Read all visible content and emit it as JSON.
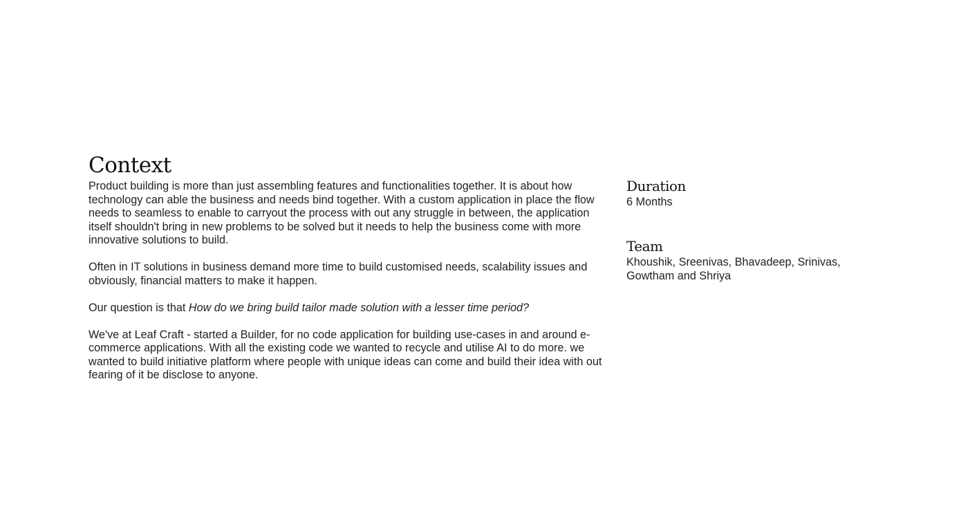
{
  "context": {
    "title": "Context",
    "paragraph_1": "Product building is more than just assembling features and functionalities together. It is about how technology can able the business and needs bind together. With a custom application in place the flow needs to seamless to enable to carryout the process with out any struggle in between, the application itself shouldn't bring in new problems to be solved but it needs to help the business come with more innovative solutions to build.",
    "paragraph_2": "Often in IT solutions in business demand more time to build customised needs, scalability issues and obviously, financial matters to make it happen.",
    "question_prefix": "Our question is that ",
    "question_emphasis": "How do we bring build tailor made solution with a lesser time period?",
    "paragraph_4": "We've at Leaf Craft - started a Builder, for no code application for building use-cases in and around e-commerce applications. With all the existing code we wanted to recycle and utilise AI to do more. we wanted to build initiative platform where people with unique ideas can come and build their idea with out fearing of it be disclose to anyone."
  },
  "duration": {
    "title": "Duration",
    "value": "6 Months"
  },
  "team": {
    "title": "Team",
    "members": "Khoushik, Sreenivas, Bhavadeep, Srinivas, Gowtham and Shriya"
  }
}
